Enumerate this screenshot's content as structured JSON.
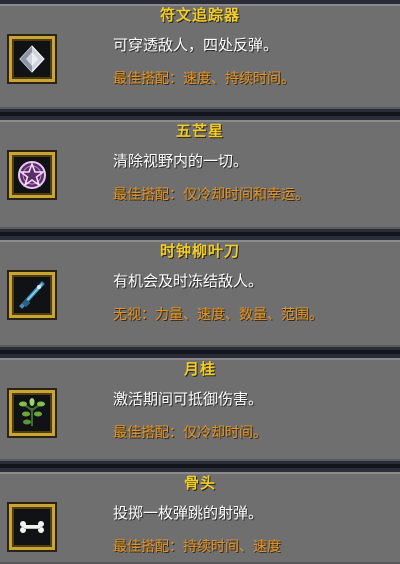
{
  "items": [
    {
      "title": "符文追踪器",
      "description": "可穿透敌人，四处反弹。",
      "hint": "最佳搭配：速度、持续时间。",
      "icon": "runetracer-diamond-icon"
    },
    {
      "title": "五芒星",
      "description": "清除视野内的一切。",
      "hint": "最佳搭配：仅冷却时间和幸运。",
      "icon": "pentagram-icon"
    },
    {
      "title": "时钟柳叶刀",
      "description": "有机会及时冻结敌人。",
      "hint": "无视：力量、速度、数量、范围。",
      "icon": "clock-lancet-icon"
    },
    {
      "title": "月桂",
      "description": "激活期间可抵御伤害。",
      "hint": "最佳搭配：仅冷却时间。",
      "icon": "laurel-icon"
    },
    {
      "title": "骨头",
      "description": "投掷一枚弹跳的射弹。",
      "hint": "最佳搭配：持续时间、速度",
      "icon": "bone-icon"
    }
  ],
  "colors": {
    "title": "#f1cc2a",
    "description": "#ffffff",
    "hint": "#e0952a",
    "card": "#6f6f70",
    "divider": "#14161e",
    "icon_border": "#caa533"
  }
}
